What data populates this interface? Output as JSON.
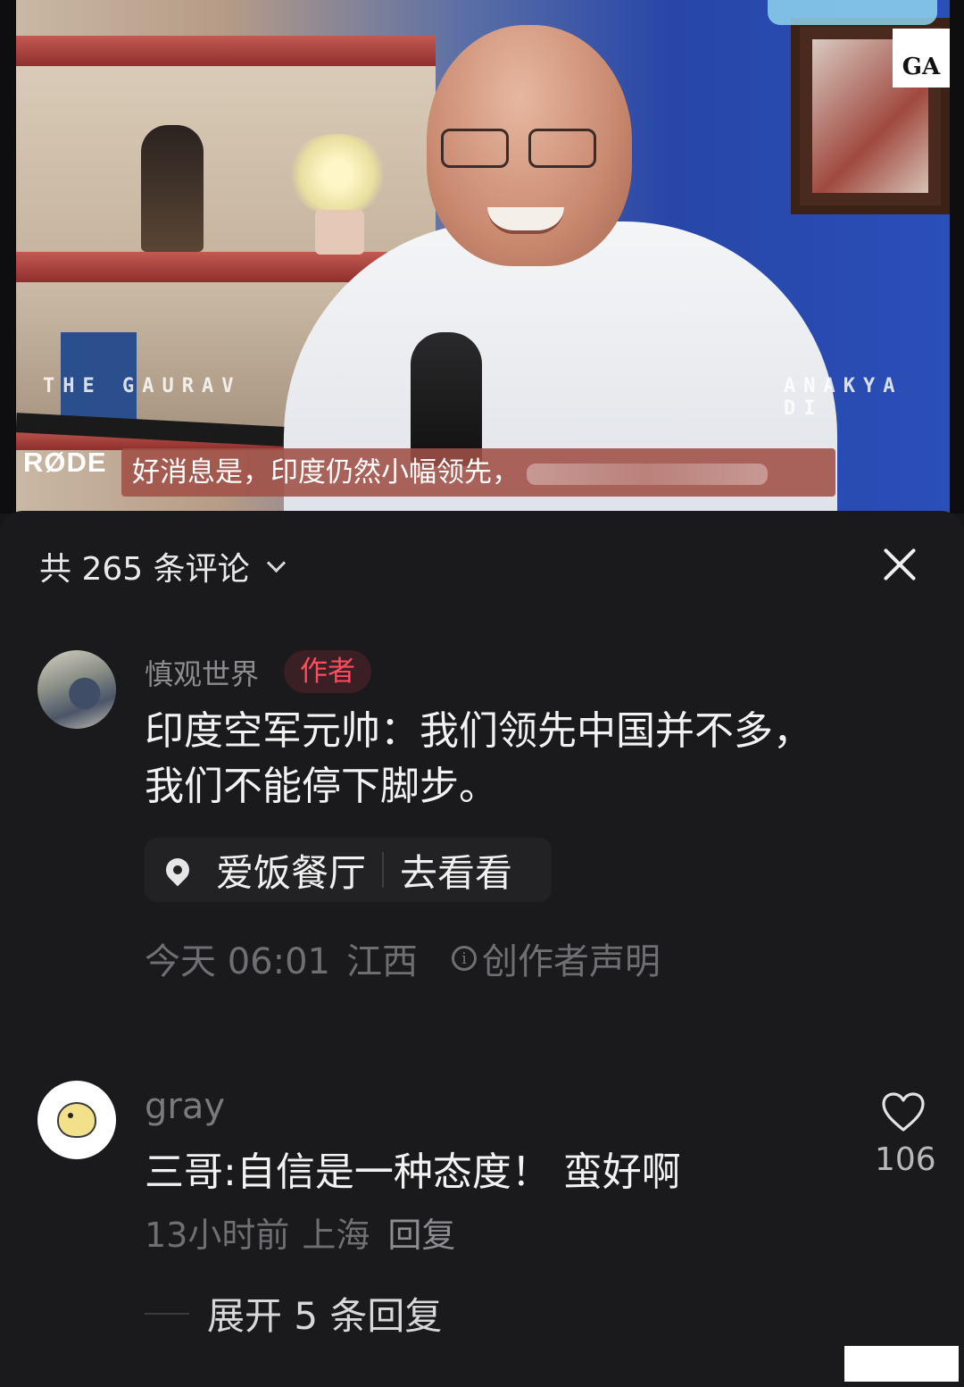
{
  "video": {
    "subtitle": "好消息是，印度仍然小幅领先，",
    "brand_mic": "RØDE",
    "overlay_left": "THE GAURAV",
    "overlay_right": "ANAKYA DI",
    "logo_text": "GA"
  },
  "comments_header": {
    "title": "共 265 条评论"
  },
  "comments": [
    {
      "username": "慎观世界",
      "badge": "作者",
      "text_line1": "印度空军元帅：我们领先中国并不多，",
      "text_line2": "我们不能停下脚步。",
      "location": "爱饭餐厅",
      "location_action": "去看看",
      "time": "今天 06:01",
      "region": "江西",
      "statement": "创作者声明"
    },
    {
      "username": "gray",
      "text": "三哥:自信是一种态度！ 蛮好啊",
      "time": "13小时前",
      "region": "上海",
      "reply": "回复",
      "likes": "106",
      "expand_replies": "展开 5 条回复"
    }
  ],
  "colors": {
    "panel_bg": "#1a1a1c",
    "author_badge": "#ff4d5e",
    "subtitle_bg": "#a05046"
  }
}
